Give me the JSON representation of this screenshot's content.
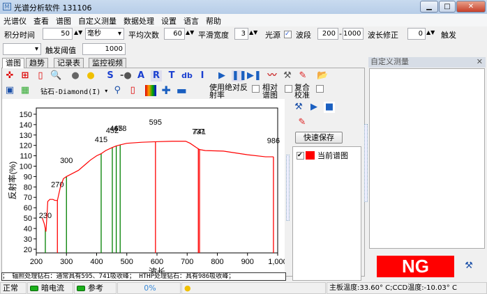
{
  "window": {
    "title": "光谱分析软件 131106",
    "app_icon": "M"
  },
  "menu": [
    "光谱仪",
    "查看",
    "谱图",
    "自定义测量",
    "数据处理",
    "设置",
    "语言",
    "帮助"
  ],
  "params": {
    "integration_label": "积分时间",
    "integration_value": "50",
    "unit": "毫秒",
    "avg_label": "平均次数",
    "avg_value": "60",
    "smooth_label": "平滑宽度",
    "smooth_value": "3",
    "light_label": "光源",
    "band_label": "波段",
    "band_from": "200",
    "band_to": "1000",
    "wl_corr_label": "波长修正",
    "wl_corr_value": "0",
    "trigger_label": "触发",
    "trigger_threshold_label": "触发阈值",
    "trigger_threshold_value": "1000"
  },
  "tabs": [
    "谱图",
    "趋势",
    "记录表",
    "监控视频"
  ],
  "toolbar": {
    "s": "S",
    "a": "A",
    "r": "R",
    "t": "T",
    "db": "db",
    "i": "I",
    "stone_select": "钻石-Diamond(I)",
    "abs_refl": "使用绝对反射率",
    "relative": "相对谱图",
    "composite": "复合校准"
  },
  "side": {
    "quick_save": "快速保存",
    "legend_item": "当前谱图",
    "legend_color": "#ff0000"
  },
  "right_panel": {
    "title": "自定义测量",
    "result": "NG",
    "result_color": "#ff0000"
  },
  "info_strip": "； 辐照处理钻石：通常具有595、741吸收峰； HTHP处理钻石：具有986吸收峰；",
  "status": {
    "mode": "正常",
    "dark": "暗电流",
    "ref": "参考",
    "progress": "0%",
    "temp": "主板温度:33.60° C;CCD温度:-10.03° C"
  },
  "chart_data": {
    "type": "line",
    "xlabel": "波长",
    "ylabel": "反射率(%)",
    "xlim": [
      200,
      1000
    ],
    "ylim": [
      16.5,
      156
    ],
    "xticks": [
      200,
      300,
      400,
      500,
      600,
      700,
      800,
      900,
      1000
    ],
    "xtick_labels": [
      "200",
      "300",
      "400",
      "500",
      "600",
      "700",
      "800",
      "900",
      "1,000"
    ],
    "yticks": [
      20,
      30,
      40,
      50,
      60,
      70,
      80,
      90,
      100,
      110,
      120,
      130,
      140,
      150
    ],
    "series": [
      {
        "name": "当前谱图",
        "color": "#ff0000",
        "x": [
          220,
          226,
          232,
          236,
          238,
          245,
          255,
          262,
          270,
          280,
          290,
          300,
          320,
          340,
          360,
          380,
          400,
          415,
          430,
          452,
          465,
          478,
          500,
          550,
          595,
          650,
          695,
          710,
          730,
          741,
          760,
          820,
          900,
          960,
          986
        ],
        "y": [
          50,
          45,
          37,
          55,
          66,
          68,
          68,
          67,
          67,
          80,
          88,
          90,
          93,
          96,
          101,
          106,
          110,
          112,
          115,
          118,
          119.5,
          120.5,
          122,
          123,
          123.5,
          124,
          124,
          122,
          118,
          116,
          115,
          114.5,
          111,
          109,
          109
        ]
      }
    ],
    "markers": [
      {
        "x": 230,
        "label": "230",
        "color": "#008000",
        "label_y": 50
      },
      {
        "x": 270,
        "label": "270",
        "color": "#ff0000",
        "label_y": 80
      },
      {
        "x": 300,
        "label": "300",
        "color": "#008000",
        "label_y": 103
      },
      {
        "x": 415,
        "label": "415",
        "color": "#008000",
        "label_y": 123
      },
      {
        "x": 452,
        "label": "452",
        "color": "#008000",
        "label_y": 132
      },
      {
        "x": 465,
        "label": "465",
        "color": "#008000",
        "label_y": 134
      },
      {
        "x": 478,
        "label": "478",
        "color": "#008000",
        "label_y": 134
      },
      {
        "x": 595,
        "label": "595",
        "color": "#ff0000",
        "label_y": 140
      },
      {
        "x": 737,
        "label": "737",
        "color": "#ff0000",
        "label_y": 131
      },
      {
        "x": 741,
        "label": "741",
        "color": "#ff0000",
        "label_y": 131
      },
      {
        "x": 986,
        "label": "986",
        "color": "#ff0000",
        "label_y": 122
      }
    ]
  }
}
